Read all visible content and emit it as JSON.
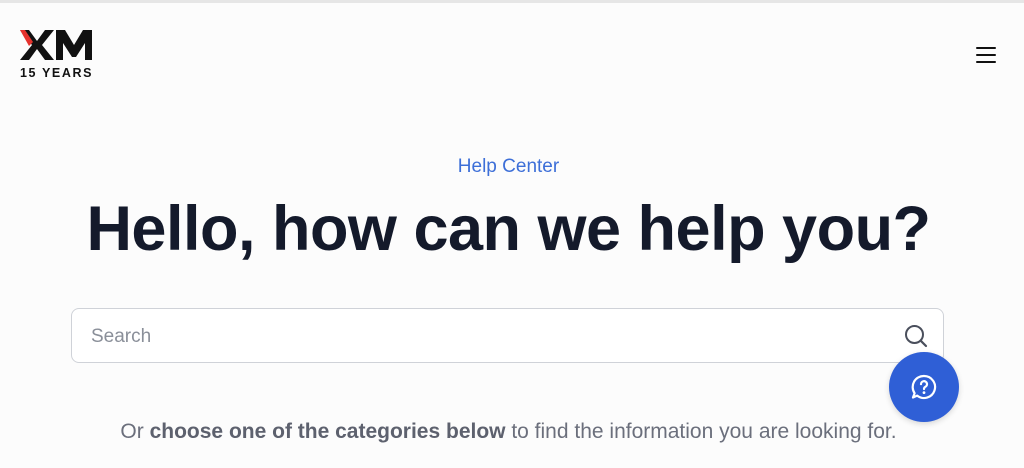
{
  "header": {
    "logo_text": "XM",
    "logo_subtext": "15 YEARS",
    "menu_icon": "hamburger-icon"
  },
  "hero": {
    "eyebrow": "Help Center",
    "title": "Hello, how can we help you?"
  },
  "search": {
    "placeholder": "Search",
    "value": "",
    "icon": "search-icon"
  },
  "help_button": {
    "icon": "question-chat-icon"
  },
  "categories_prompt": {
    "prefix": "Or ",
    "emphasis": "choose one of the categories below",
    "suffix": " to find the information you are looking for."
  },
  "colors": {
    "accent": "#2f5fd6",
    "eyebrow": "#3d6fd8",
    "heading": "#141a2b",
    "logo_red": "#e5322d"
  }
}
